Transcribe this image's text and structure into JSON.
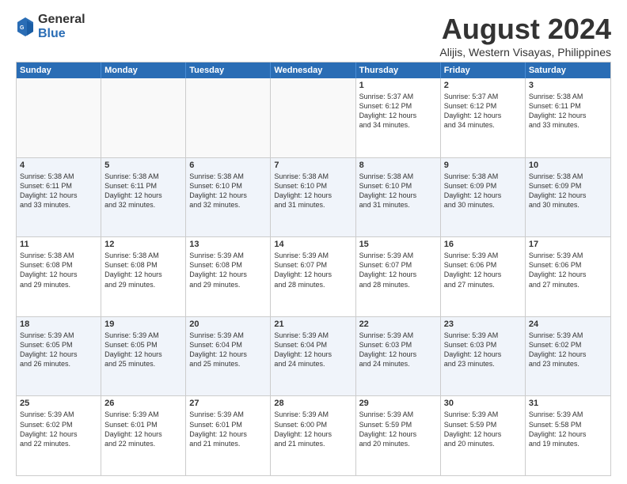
{
  "logo": {
    "general": "General",
    "blue": "Blue"
  },
  "title": "August 2024",
  "subtitle": "Alijis, Western Visayas, Philippines",
  "days_of_week": [
    "Sunday",
    "Monday",
    "Tuesday",
    "Wednesday",
    "Thursday",
    "Friday",
    "Saturday"
  ],
  "weeks": [
    [
      {
        "day": "",
        "empty": true
      },
      {
        "day": "",
        "empty": true
      },
      {
        "day": "",
        "empty": true
      },
      {
        "day": "",
        "empty": true
      },
      {
        "day": "1",
        "info": "Sunrise: 5:37 AM\nSunset: 6:12 PM\nDaylight: 12 hours\nand 34 minutes."
      },
      {
        "day": "2",
        "info": "Sunrise: 5:37 AM\nSunset: 6:12 PM\nDaylight: 12 hours\nand 34 minutes."
      },
      {
        "day": "3",
        "info": "Sunrise: 5:38 AM\nSunset: 6:11 PM\nDaylight: 12 hours\nand 33 minutes."
      }
    ],
    [
      {
        "day": "4",
        "info": "Sunrise: 5:38 AM\nSunset: 6:11 PM\nDaylight: 12 hours\nand 33 minutes."
      },
      {
        "day": "5",
        "info": "Sunrise: 5:38 AM\nSunset: 6:11 PM\nDaylight: 12 hours\nand 32 minutes."
      },
      {
        "day": "6",
        "info": "Sunrise: 5:38 AM\nSunset: 6:10 PM\nDaylight: 12 hours\nand 32 minutes."
      },
      {
        "day": "7",
        "info": "Sunrise: 5:38 AM\nSunset: 6:10 PM\nDaylight: 12 hours\nand 31 minutes."
      },
      {
        "day": "8",
        "info": "Sunrise: 5:38 AM\nSunset: 6:10 PM\nDaylight: 12 hours\nand 31 minutes."
      },
      {
        "day": "9",
        "info": "Sunrise: 5:38 AM\nSunset: 6:09 PM\nDaylight: 12 hours\nand 30 minutes."
      },
      {
        "day": "10",
        "info": "Sunrise: 5:38 AM\nSunset: 6:09 PM\nDaylight: 12 hours\nand 30 minutes."
      }
    ],
    [
      {
        "day": "11",
        "info": "Sunrise: 5:38 AM\nSunset: 6:08 PM\nDaylight: 12 hours\nand 29 minutes."
      },
      {
        "day": "12",
        "info": "Sunrise: 5:38 AM\nSunset: 6:08 PM\nDaylight: 12 hours\nand 29 minutes."
      },
      {
        "day": "13",
        "info": "Sunrise: 5:39 AM\nSunset: 6:08 PM\nDaylight: 12 hours\nand 29 minutes."
      },
      {
        "day": "14",
        "info": "Sunrise: 5:39 AM\nSunset: 6:07 PM\nDaylight: 12 hours\nand 28 minutes."
      },
      {
        "day": "15",
        "info": "Sunrise: 5:39 AM\nSunset: 6:07 PM\nDaylight: 12 hours\nand 28 minutes."
      },
      {
        "day": "16",
        "info": "Sunrise: 5:39 AM\nSunset: 6:06 PM\nDaylight: 12 hours\nand 27 minutes."
      },
      {
        "day": "17",
        "info": "Sunrise: 5:39 AM\nSunset: 6:06 PM\nDaylight: 12 hours\nand 27 minutes."
      }
    ],
    [
      {
        "day": "18",
        "info": "Sunrise: 5:39 AM\nSunset: 6:05 PM\nDaylight: 12 hours\nand 26 minutes."
      },
      {
        "day": "19",
        "info": "Sunrise: 5:39 AM\nSunset: 6:05 PM\nDaylight: 12 hours\nand 25 minutes."
      },
      {
        "day": "20",
        "info": "Sunrise: 5:39 AM\nSunset: 6:04 PM\nDaylight: 12 hours\nand 25 minutes."
      },
      {
        "day": "21",
        "info": "Sunrise: 5:39 AM\nSunset: 6:04 PM\nDaylight: 12 hours\nand 24 minutes."
      },
      {
        "day": "22",
        "info": "Sunrise: 5:39 AM\nSunset: 6:03 PM\nDaylight: 12 hours\nand 24 minutes."
      },
      {
        "day": "23",
        "info": "Sunrise: 5:39 AM\nSunset: 6:03 PM\nDaylight: 12 hours\nand 23 minutes."
      },
      {
        "day": "24",
        "info": "Sunrise: 5:39 AM\nSunset: 6:02 PM\nDaylight: 12 hours\nand 23 minutes."
      }
    ],
    [
      {
        "day": "25",
        "info": "Sunrise: 5:39 AM\nSunset: 6:02 PM\nDaylight: 12 hours\nand 22 minutes."
      },
      {
        "day": "26",
        "info": "Sunrise: 5:39 AM\nSunset: 6:01 PM\nDaylight: 12 hours\nand 22 minutes."
      },
      {
        "day": "27",
        "info": "Sunrise: 5:39 AM\nSunset: 6:01 PM\nDaylight: 12 hours\nand 21 minutes."
      },
      {
        "day": "28",
        "info": "Sunrise: 5:39 AM\nSunset: 6:00 PM\nDaylight: 12 hours\nand 21 minutes."
      },
      {
        "day": "29",
        "info": "Sunrise: 5:39 AM\nSunset: 5:59 PM\nDaylight: 12 hours\nand 20 minutes."
      },
      {
        "day": "30",
        "info": "Sunrise: 5:39 AM\nSunset: 5:59 PM\nDaylight: 12 hours\nand 20 minutes."
      },
      {
        "day": "31",
        "info": "Sunrise: 5:39 AM\nSunset: 5:58 PM\nDaylight: 12 hours\nand 19 minutes."
      }
    ]
  ]
}
